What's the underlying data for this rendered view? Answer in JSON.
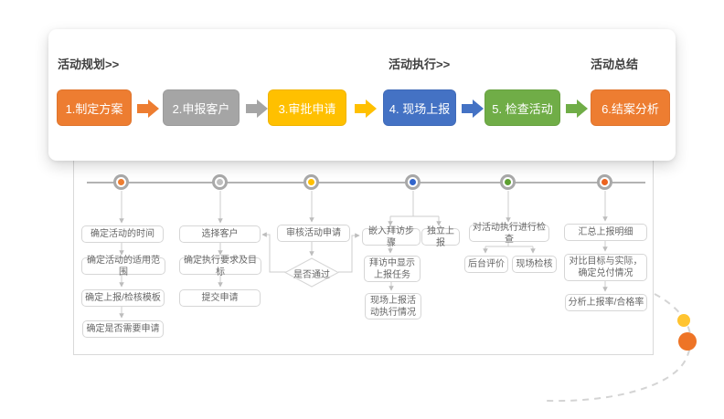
{
  "card": {
    "phases": [
      {
        "label": "活动规划>>"
      },
      {
        "label": "活动执行>>"
      },
      {
        "label": "活动总结"
      }
    ],
    "steps": [
      {
        "label": "1.制定方案",
        "color": "#ED7D31"
      },
      {
        "label": "2.申报客户",
        "color": "#A5A5A5"
      },
      {
        "label": "3.审批申请",
        "color": "#FFC000"
      },
      {
        "label": "4. 现场上报",
        "color": "#4472C4"
      },
      {
        "label": "5. 检查活动",
        "color": "#70AD47"
      },
      {
        "label": "6.结案分析",
        "color": "#ED7D31"
      }
    ]
  },
  "timeline": {
    "dot_colors": [
      "#ED7D31",
      "#BFBFBF",
      "#FFC000",
      "#3366CC",
      "#5EA032",
      "#ED6420"
    ],
    "line_color": "#b3b3b3",
    "ring_color": "#a9a9a9"
  },
  "flow": {
    "col1": [
      "确定活动的时间",
      "确定活动的适用范围",
      "确定上报/检核模板",
      "确定是否需要申请"
    ],
    "col2": [
      "选择客户",
      "确定执行要求及目标",
      "提交申请"
    ],
    "col3": {
      "review": "审核活动申请",
      "decision": "是否通过"
    },
    "col4": [
      "嵌入拜访步骤",
      "独立上报",
      "拜访中显示上报任务",
      "现场上报活动执行情况"
    ],
    "col5": [
      "对活动执行进行检查",
      "后台评价",
      "现场检核"
    ],
    "col6": [
      "汇总上报明细",
      "对比目标与实际，确定兑付情况",
      "分析上报率/合格率"
    ]
  },
  "decor": {
    "small_dot_color": "#FFC430",
    "large_dot_color": "#EE7426",
    "curve_color": "#d4d4d4"
  }
}
